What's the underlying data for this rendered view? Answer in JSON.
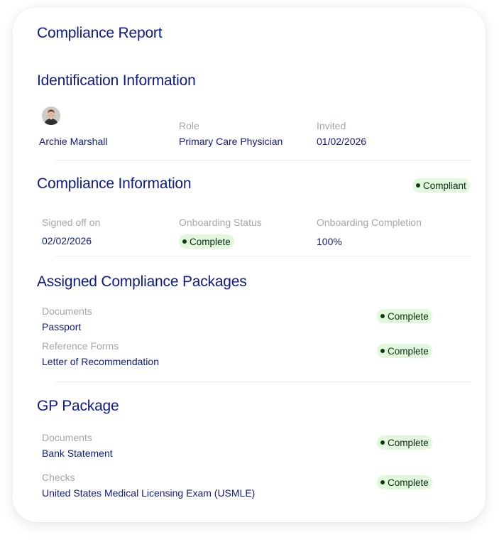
{
  "report": {
    "title": "Compliance Report"
  },
  "identification": {
    "heading": "Identification Information",
    "name": "Archie Marshall",
    "role_label": "Role",
    "role_value": "Primary Care Physician",
    "invited_label": "Invited",
    "invited_value": "01/02/2026"
  },
  "compliance": {
    "heading": "Compliance Information",
    "status_badge": "Compliant",
    "signed_label": "Signed off on",
    "signed_value": "02/02/2026",
    "onboarding_status_label": "Onboarding Status",
    "onboarding_status_value": "Complete",
    "onboarding_completion_label": "Onboarding Completion",
    "onboarding_completion_value": "100%"
  },
  "assigned_packages": {
    "heading": "Assigned Compliance Packages",
    "items": [
      {
        "category": "Documents",
        "name": "Passport",
        "status": "Complete"
      },
      {
        "category": "Reference Forms",
        "name": "Letter of Recommendation",
        "status": "Complete"
      }
    ]
  },
  "gp_package": {
    "heading": "GP Package",
    "items": [
      {
        "category": "Documents",
        "name": "Bank Statement",
        "status": "Complete"
      },
      {
        "category": "Checks",
        "name": "United States Medical Licensing Exam (USMLE)",
        "status": "Complete"
      }
    ]
  },
  "colors": {
    "heading": "#0d1a8a",
    "label": "#a3a7ad",
    "badge_bg": "#e2f8dc",
    "badge_dot": "#0e3b13"
  }
}
